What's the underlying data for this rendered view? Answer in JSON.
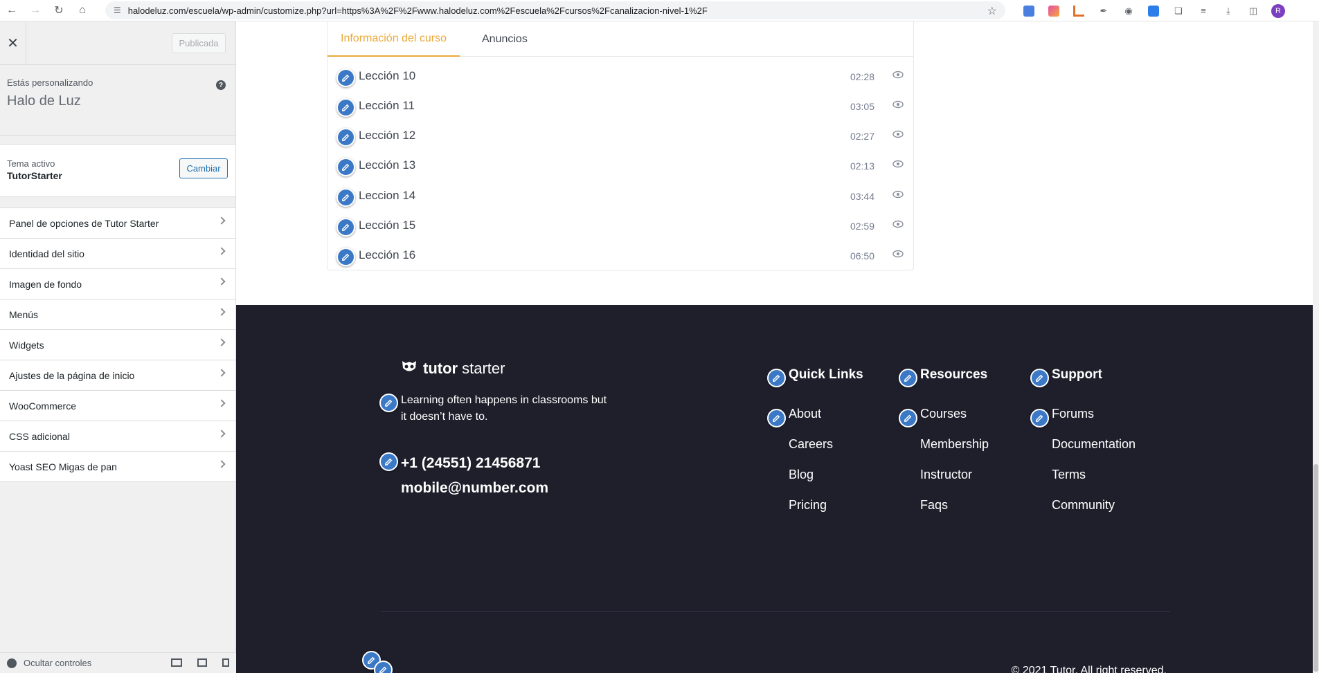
{
  "browser": {
    "url": "halodeluz.com/escuela/wp-admin/customize.php?url=https%3A%2F%2Fwww.halodeluz.com%2Fescuela%2Fcursos%2Fcanalizacion-nivel-1%2F",
    "profile_initial": "R"
  },
  "sidebar": {
    "publish_label": "Publicada",
    "customizing_label": "Estás personalizando",
    "site_name": "Halo de Luz",
    "help_label": "?",
    "theme_label": "Tema activo",
    "theme_name": "TutorStarter",
    "change_label": "Cambiar",
    "items": [
      {
        "label": "Panel de opciones de Tutor Starter"
      },
      {
        "label": "Identidad del sitio"
      },
      {
        "label": "Imagen de fondo"
      },
      {
        "label": "Menús"
      },
      {
        "label": "Widgets"
      },
      {
        "label": "Ajustes de la página de inicio"
      },
      {
        "label": "WooCommerce"
      },
      {
        "label": "CSS adicional"
      },
      {
        "label": "Yoast SEO Migas de pan"
      }
    ],
    "hide_controls_label": "Ocultar controles"
  },
  "course": {
    "tabs": [
      {
        "label": "Información del curso"
      },
      {
        "label": "Anuncios"
      }
    ],
    "lessons": [
      {
        "title": "Lección 10",
        "duration": "02:28"
      },
      {
        "title": "Lección 11",
        "duration": "03:05"
      },
      {
        "title": "Lección 12",
        "duration": "02:27"
      },
      {
        "title": "Lección 13",
        "duration": "02:13"
      },
      {
        "title": "Leccion 14",
        "duration": "03:44"
      },
      {
        "title": "Lección 15",
        "duration": "02:59"
      },
      {
        "title": "Lección 16",
        "duration": "06:50"
      }
    ]
  },
  "footer": {
    "brand_bold": "tutor",
    "brand_light": "starter",
    "tagline": "Learning often happens in classrooms but it doesn’t have to.",
    "phone": "+1 (24551) 21456871",
    "email": "mobile@number.com",
    "columns": [
      {
        "heading": "Quick Links",
        "links": [
          "About",
          "Careers",
          "Blog",
          "Pricing"
        ]
      },
      {
        "heading": "Resources",
        "links": [
          "Courses",
          "Membership",
          "Instructor",
          "Faqs"
        ]
      },
      {
        "heading": "Support",
        "links": [
          "Forums",
          "Documentation",
          "Terms",
          "Community"
        ]
      }
    ],
    "copyright": "© 2021 Tutor. All right reserved."
  },
  "colors": {
    "accent": "#e9a93a",
    "footer_bg": "#1f1f2c",
    "edit_shortcut": "#3b79c7",
    "wp_blue": "#2271b1"
  }
}
